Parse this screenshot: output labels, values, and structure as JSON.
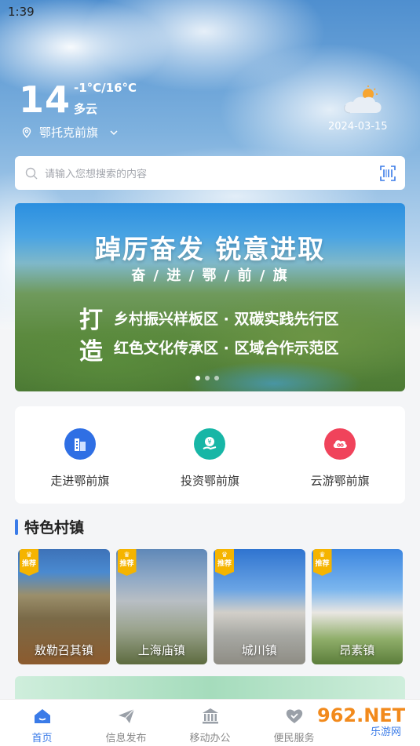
{
  "status_bar": {
    "time": "1:39"
  },
  "weather": {
    "temperature": "14",
    "range": "-1°C/16°C",
    "condition": "多云",
    "location": "鄂托克前旗",
    "date": "2024-03-15",
    "icon": "cloud-sun-icon"
  },
  "search": {
    "placeholder": "请输入您想搜索的内容"
  },
  "banner": {
    "title": "踔厉奋发  锐意进取",
    "subtitle": "奋 / 进 / 鄂 / 前 / 旗",
    "big_char_1": "打",
    "big_char_2": "造",
    "line_1": "乡村振兴样板区 · 双碳实践先行区",
    "line_2": "红色文化传承区 · 区域合作示范区",
    "slide_count": 3,
    "active_slide": 1
  },
  "quick_actions": [
    {
      "label": "走进鄂前旗",
      "icon": "building-icon",
      "color": "#2f6fe4"
    },
    {
      "label": "投资鄂前旗",
      "icon": "invest-icon",
      "color": "#17b6a6"
    },
    {
      "label": "云游鄂前旗",
      "icon": "cloud-tour-icon",
      "color": "#f0435b"
    }
  ],
  "featured": {
    "title": "特色村镇",
    "badge": "推荐",
    "towns": [
      {
        "name": "敖勒召其镇"
      },
      {
        "name": "上海庙镇"
      },
      {
        "name": "城川镇"
      },
      {
        "name": "昂素镇"
      }
    ]
  },
  "tabbar": {
    "items": [
      {
        "label": "首页",
        "icon": "home-icon",
        "active": true
      },
      {
        "label": "信息发布",
        "icon": "send-icon",
        "active": false
      },
      {
        "label": "移动办公",
        "icon": "bank-icon",
        "active": false
      },
      {
        "label": "便民服务",
        "icon": "heart-icon",
        "active": false
      }
    ]
  },
  "watermark": {
    "text": "962.NET",
    "subtext": "乐游网"
  },
  "colors": {
    "accent": "#3a7be8",
    "badge": "#f5b400"
  }
}
